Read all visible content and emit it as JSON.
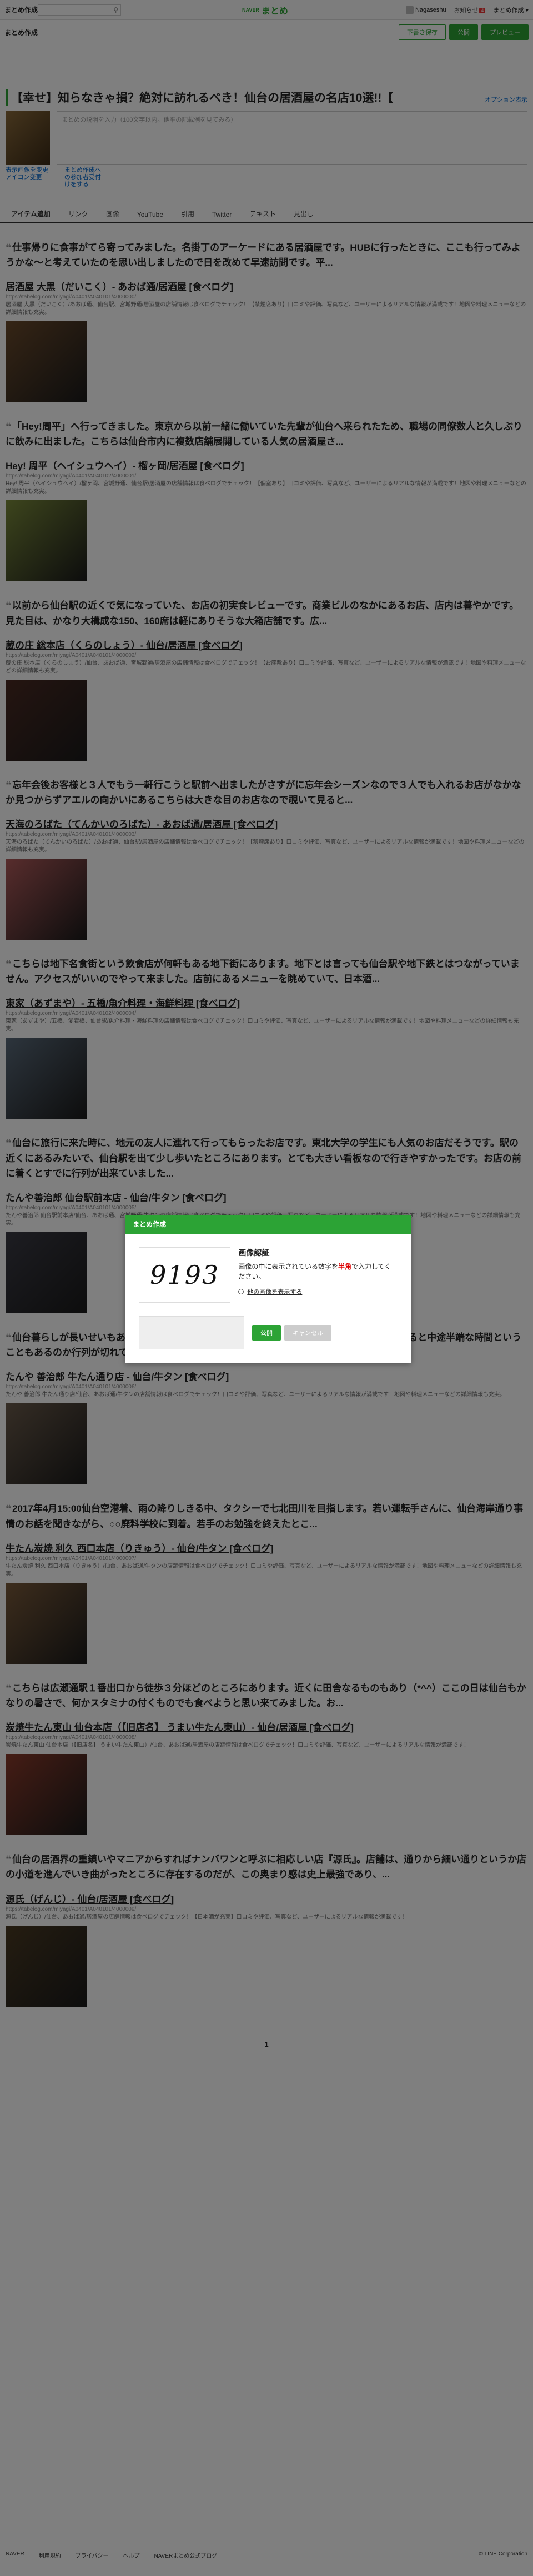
{
  "header": {
    "brand": "まとめ作成",
    "logo_small": "NAVER",
    "logo_text": "まとめ",
    "user": "Nagaseshu",
    "notifications_label": "お知らせ",
    "notification_count": "4",
    "menu_label": "まとめ作成"
  },
  "subbar": {
    "title": "まとめ作成",
    "save_draft": "下書き保存",
    "publish": "公開",
    "preview": "プレビュー"
  },
  "article": {
    "title": "【幸せ】知らなきゃ損？絶対に訪れるべき！仙台の居酒屋の名店10選!!【",
    "title_option": "オプション表示",
    "description_placeholder": "まとめの説明を入力（100文字以内。他平の記載例を見てみる）",
    "thumb_link_1": "表示画像を変更",
    "thumb_link_2": "アイコン変更",
    "checkbox_label": "まとめ作成への参加者受付けをする"
  },
  "tabs": [
    "アイテム追加",
    "リンク",
    "画像",
    "YouTube",
    "引用",
    "Twitter",
    "テキスト",
    "見出し"
  ],
  "items": [
    {
      "quote": "仕事帰りに食事がてら寄ってみました。名掛丁のアーケードにある居酒屋です。HUBに行ったときに、ここも行ってみようかな～と考えていたのを思い出しましたので日を改めて早速訪問です。平...",
      "link_title": "居酒屋 大黒（だいこく）- あおば通/居酒屋 [食べログ]",
      "url": "https://tabelog.com/miyagi/A0401/A040101/4000000/",
      "desc": "居酒屋 大黒（だいこく）/あおば通、仙台駅、宮城野通/居酒屋の店舗情報は食べログでチェック！【禁煙席あり】口コミや評価、写真など、ユーザーによるリアルな情報が満載です！地図や料理メニューなどの詳細情報も充実。",
      "photo_color": "#6b4a2b"
    },
    {
      "quote": "「Hey!周平」へ行ってきました。東京から以前一緒に働いていた先輩が仙台へ来られたため、職場の同僚数人と久しぶりに飲みに出ました。こちらは仙台市内に複数店舗展開している人気の居酒屋さ...",
      "link_title": "Hey! 周平（ヘイシュウヘイ）- 榴ヶ岡/居酒屋 [食べログ]",
      "url": "https://tabelog.com/miyagi/A0401/A040102/4000001/",
      "desc": "Hey! 周平（ヘイシュウヘイ）/榴ヶ岡、宮城野通、仙台駅/居酒屋の店舗情報は食べログでチェック！【個室あり】口コミや評価、写真など、ユーザーによるリアルな情報が満載です！地図や料理メニューなどの詳細情報も充実。",
      "photo_color": "#7a8a3a"
    },
    {
      "quote": "以前から仙台駅の近くで気になっていた、お店の初実食レビューです。商業ビルのなかにあるお店、店内は暮やかです。見た目は、かなり大構成な150、160席は軽にありそうな大箱店舗です。広...",
      "link_title": "蔵の庄 総本店（くらのしょう）- 仙台/居酒屋 [食べログ]",
      "url": "https://tabelog.com/miyagi/A0401/A040101/4000002/",
      "desc": "蔵の庄 総本店（くらのしょう）/仙台、あおば通、宮城野通/居酒屋の店舗情報は食べログでチェック！【お座敷あり】口コミや評価、写真など、ユーザーによるリアルな情報が満載です！地図や料理メニューなどの詳細情報も充実。",
      "photo_color": "#4a2a22"
    },
    {
      "quote": "忘年会後お客様と３人でもう一軒行こうと駅前へ出ましたがさすがに忘年会シーズンなので３人でも入れるお店がなかなか見つからずアエルの向かいにあるこちらは大きな目のお店なので覗いて見ると...",
      "link_title": "天海のろばた（てんかいのろばた）- あおば通/居酒屋 [食べログ]",
      "url": "https://tabelog.com/miyagi/A0401/A040101/4000003/",
      "desc": "天海のろばた（てんかいのろばた）/あおば通、仙台駅/居酒屋の店舗情報は食べログでチェック！【禁煙席あり】口コミや評価、写真など、ユーザーによるリアルな情報が満載です！地図や料理メニューなどの詳細情報も充実。",
      "photo_color": "#b05a5a"
    },
    {
      "quote": "こちらは地下名食街という飲食店が何軒もある地下街にあります。地下とは言っても仙台駅や地下鉄とはつながっていません。アクセスがいいのでやって来ました。店前にあるメニューを眺めていて、日本酒...",
      "link_title": "東家（あずまや）- 五橋/魚介料理・海鮮料理 [食べログ]",
      "url": "https://tabelog.com/miyagi/A0401/A040102/4000004/",
      "desc": "東家（あずまや）/五橋、愛宕橋、仙台駅/魚介料理・海鮮料理の店舗情報は食べログでチェック！口コミや評価、写真など、ユーザーによるリアルな情報が満載です！地図や料理メニューなどの詳細情報も充実。",
      "photo_color": "#5a6a7a"
    },
    {
      "quote": "仙台に旅行に来た時に、地元の友人に連れて行ってもらったお店です。東北大学の学生にも人気のお店だそうです。駅の近くにあるみたいで、仙台駅を出て少し歩いたところにあります。とても大きい看板なので行きやすかったです。お店の前に着くとすでに行列が出来ていました...",
      "link_title": "たんや善治郎 仙台駅前本店 - 仙台/牛タン [食べログ]",
      "url": "https://tabelog.com/miyagi/A0401/A040101/4000005/",
      "desc": "たんや善治郎 仙台駅前本店/仙台、あおば通、宮城野通/牛タンの店舗情報は食べログでチェック！口コミや評価、写真など、ユーザーによるリアルな情報が満載です！地図や料理メニューなどの詳細情報も充実。",
      "photo_color": "#3a3a44"
    },
    {
      "quote": "仙台暮らしが長いせいもあるのかな？好んで牛タンをいただく方ではないが牛タン通りを眺めると中途半端な時間ということもあるのか行列が切れていたので何ったのは仙台のあちらこちらにあるこち...",
      "link_title": "たんや 善治郎 牛たん通り店 - 仙台/牛タン [食べログ]",
      "url": "https://tabelog.com/miyagi/A0401/A040101/4000006/",
      "desc": "たんや 善治郎 牛たん通り店/仙台、あおば通/牛タンの店舗情報は食べログでチェック！口コミや評価、写真など、ユーザーによるリアルな情報が満載です！地図や料理メニューなどの詳細情報も充実。",
      "photo_color": "#6a5a4a"
    },
    {
      "quote": "2017年4月15:00仙台空港着、雨の降りしきる中、タクシーで七北田川を目指します。若い運転手さんに、仙台海岸通り事情のお話を聞きながら、○○廃料学校に到着。若手のお勉強を終えたとこ...",
      "link_title": "牛たん炭焼 利久 西口本店（りきゅう）- 仙台/牛タン [食べログ]",
      "url": "https://tabelog.com/miyagi/A0401/A040101/4000007/",
      "desc": "牛たん炭焼 利久 西口本店（りきゅう）/仙台、あおば通/牛タンの店舗情報は食べログでチェック！口コミや評価、写真など、ユーザーによるリアルな情報が満載です！地図や料理メニューなどの詳細情報も充実。",
      "photo_color": "#7a5a3a"
    },
    {
      "quote": "こちらは広瀬通駅１番出口から徒歩３分ほどのところにあります。近くに田舎なるものもあり（*^^）ここの日は仙台もかなりの暑さで、何かスタミナの付くものでも食べようと思い来てみました。お...",
      "link_title": "炭焼牛たん東山 仙台本店（【旧店名】 うまい牛たん東山）- 仙台/居酒屋 [食べログ]",
      "url": "https://tabelog.com/miyagi/A0401/A040101/4000008/",
      "desc": "炭焼牛たん東山 仙台本店（【旧店名】 うまい牛たん東山）/仙台、あおば通/居酒屋の店舗情報は食べログでチェック！口コミや評価、写真など、ユーザーによるリアルな情報が満載です！",
      "photo_color": "#8a3a2a"
    },
    {
      "quote": "仙台の居酒界の重鎮いやマニアからすればナンバワンと呼ぶに相応しい店『源氏』。店舗は、通りから細い通りというか店の小道を進んでいき曲がったところに存在するのだが、この奥まり感は史上最強であり、...",
      "link_title": "源氏（げんじ）- 仙台/居酒屋 [食べログ]",
      "url": "https://tabelog.com/miyagi/A0401/A040101/4000009/",
      "desc": "源氏（げんじ）/仙台、あおば通/居酒屋の店舗情報は食べログでチェック！【日本酒が充実】口コミや評価、写真など、ユーザーによるリアルな情報が満載です！",
      "photo_color": "#4a3a22"
    }
  ],
  "pagination": "1",
  "footer": {
    "links": [
      "NAVER",
      "利用規約",
      "プライバシー",
      "ヘルプ",
      "NAVERまとめ公式ブログ"
    ],
    "copyright": "© LINE Corporation"
  },
  "modal": {
    "header": "まとめ作成",
    "captcha_code": "9193",
    "heading": "画像認証",
    "text_before": "画像の中に表示されている数字を",
    "text_red": "半角",
    "text_after": "で入力してください。",
    "alt_link": "他の画像を表示する",
    "ok": "公開",
    "cancel": "キャンセル"
  }
}
